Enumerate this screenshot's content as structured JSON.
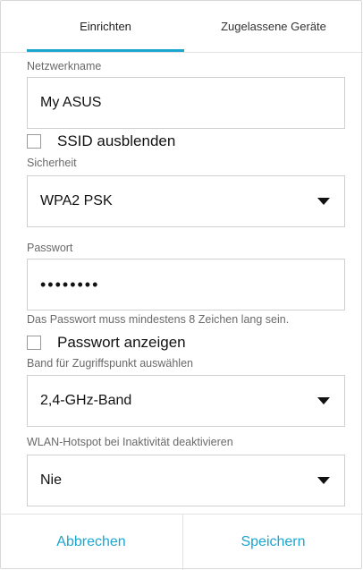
{
  "tabs": [
    {
      "label": "Einrichten",
      "active": true
    },
    {
      "label": "Zugelassene Geräte",
      "active": false
    }
  ],
  "network_name": {
    "label": "Netzwerkname",
    "value": "My ASUS"
  },
  "hide_ssid": {
    "label": "SSID ausblenden",
    "checked": false
  },
  "security": {
    "label": "Sicherheit",
    "value": "WPA2 PSK"
  },
  "password": {
    "label": "Passwort",
    "value": "••••••••",
    "hint": "Das Passwort muss mindestens 8 Zeichen lang sein."
  },
  "show_password": {
    "label": "Passwort anzeigen",
    "checked": false
  },
  "band": {
    "label": "Band für Zugriffspunkt auswählen",
    "value": "2,4-GHz-Band"
  },
  "inactivity": {
    "label": "WLAN-Hotspot bei Inaktivität deaktivieren",
    "value": "Nie"
  },
  "footer": {
    "cancel_label": "Abbrechen",
    "save_label": "Speichern"
  },
  "colors": {
    "accent": "#1ba6cf",
    "border": "#d0d0d0"
  },
  "icons": {
    "dropdown": "dropdown-caret-icon"
  }
}
